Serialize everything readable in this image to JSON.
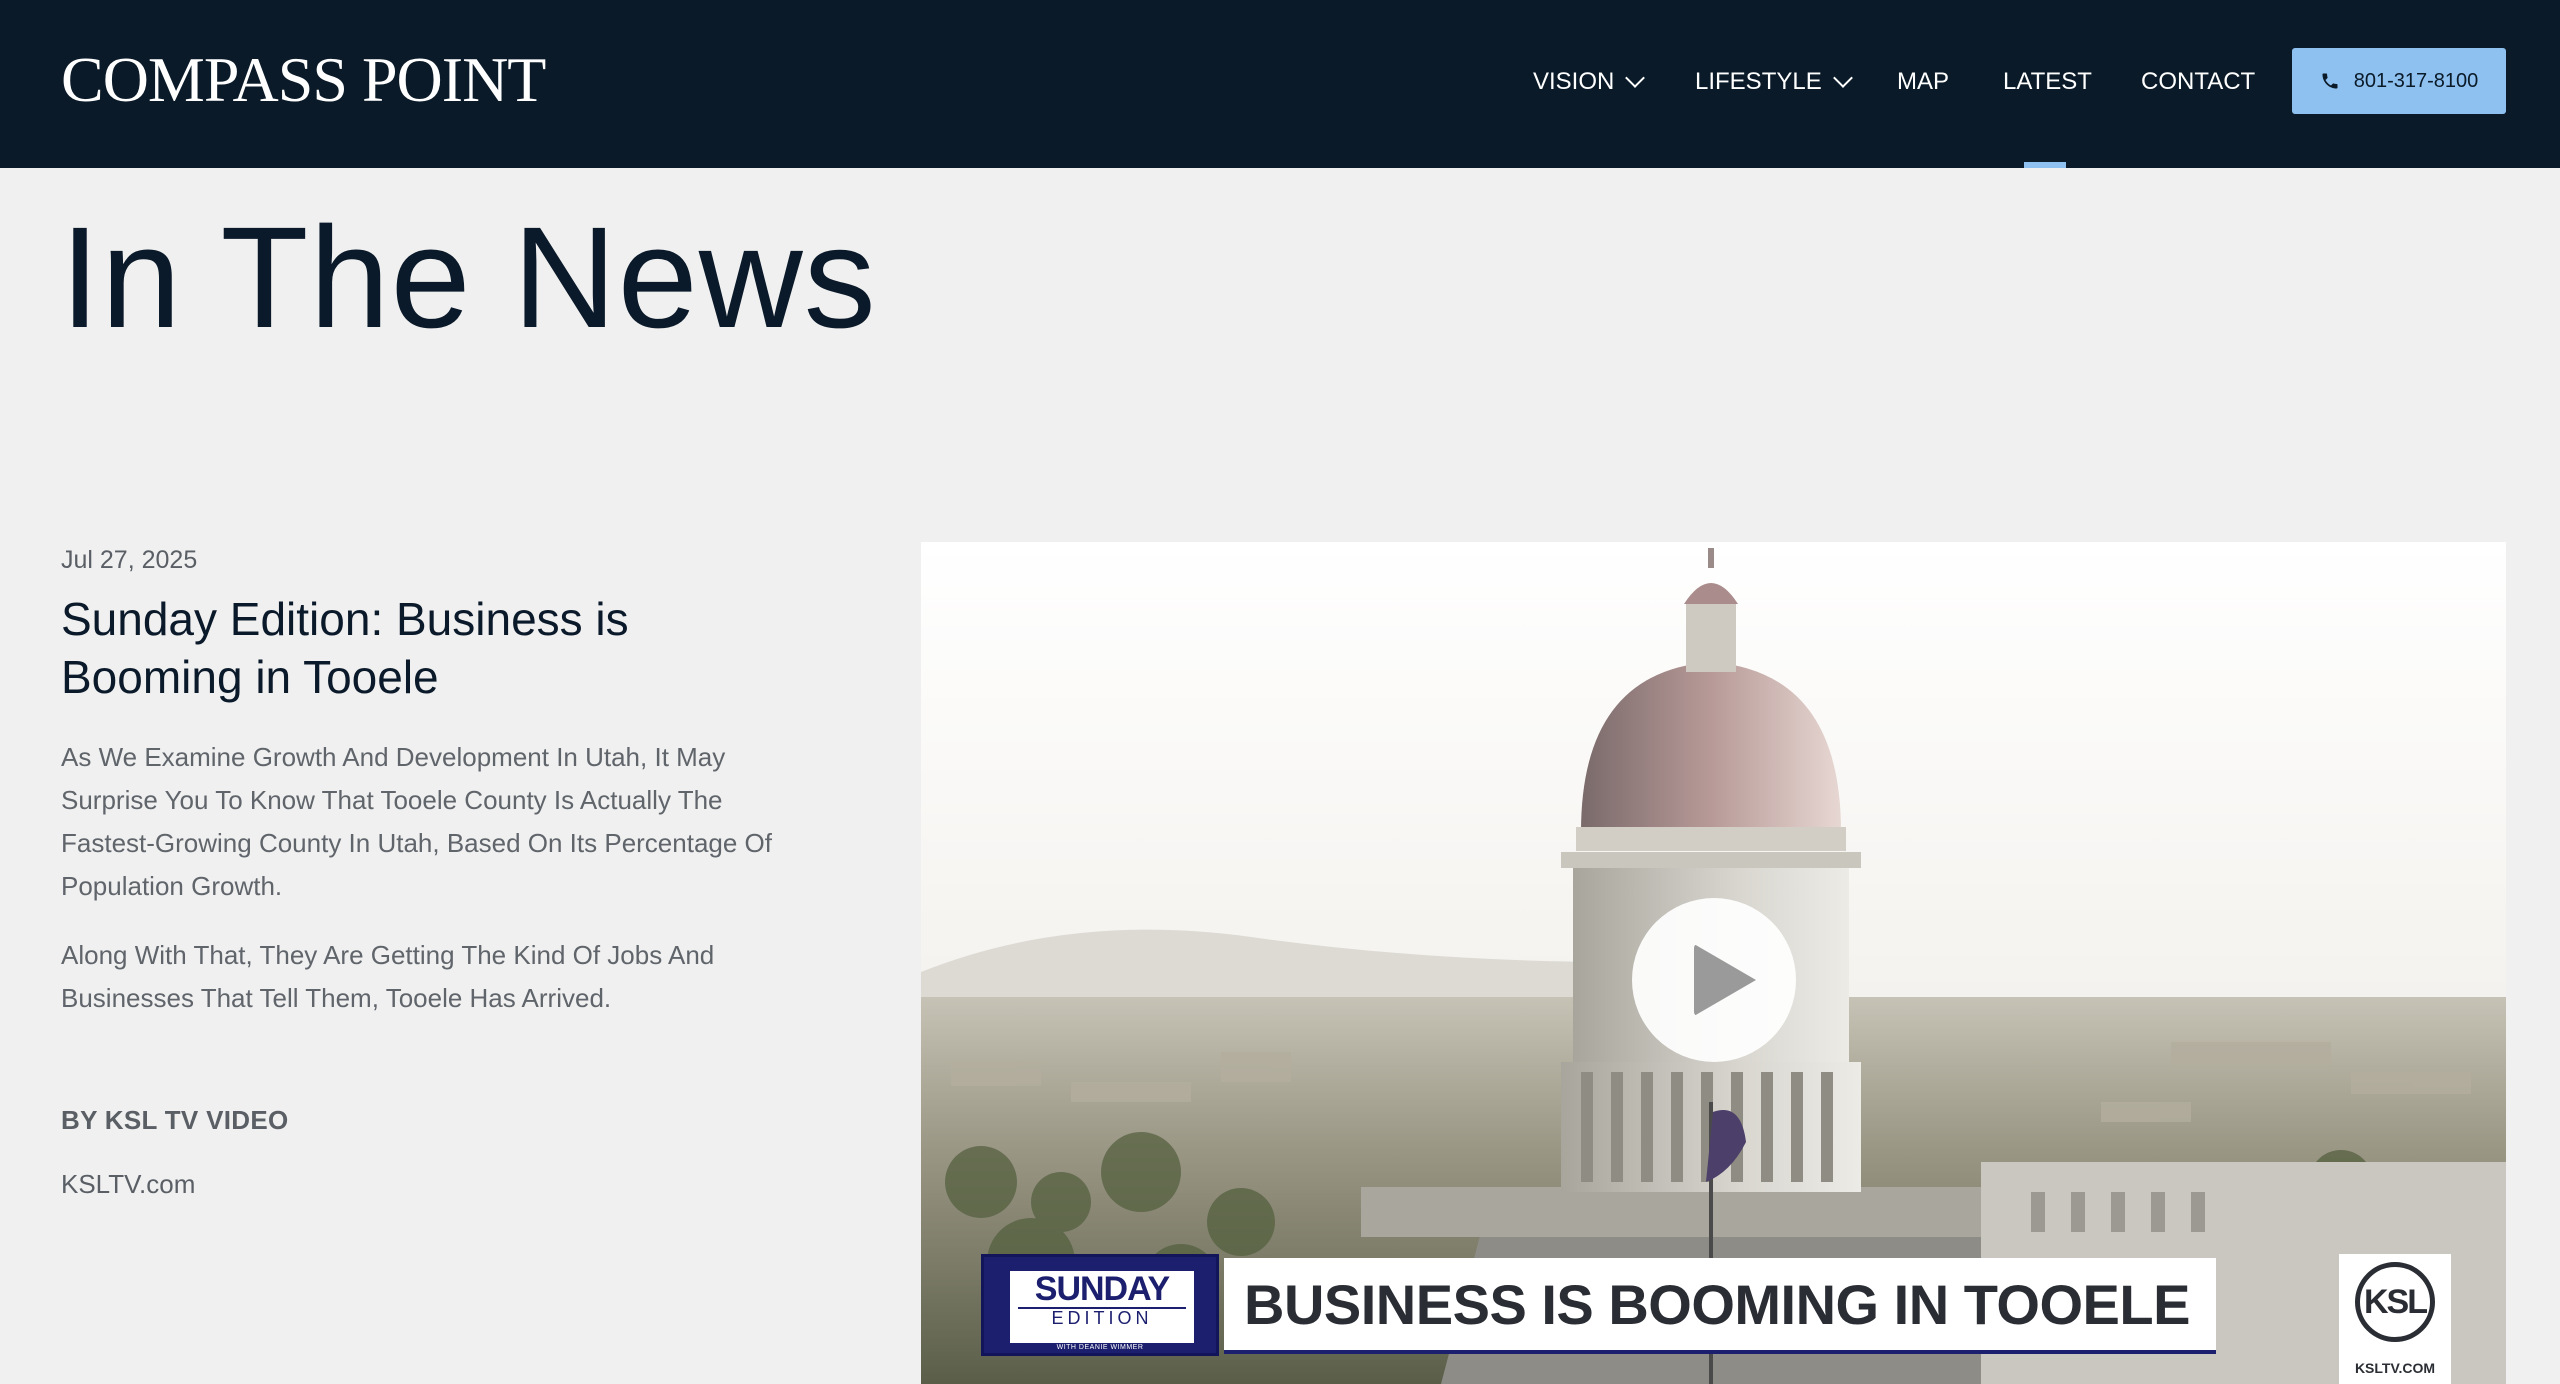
{
  "header": {
    "logo": "COMPASS POINT",
    "nav": [
      {
        "label": "VISION",
        "has_dropdown": true
      },
      {
        "label": "LIFESTYLE",
        "has_dropdown": true
      },
      {
        "label": "MAP",
        "has_dropdown": false
      },
      {
        "label": "LATEST",
        "has_dropdown": false,
        "active": true
      },
      {
        "label": "CONTACT",
        "has_dropdown": false
      }
    ],
    "phone": "801-317-8100",
    "phone_icon": "phone-icon"
  },
  "page": {
    "title": "In The News"
  },
  "article": {
    "date": "Jul 27, 2025",
    "title": "Sunday Edition: Business is Booming in Tooele",
    "paragraphs": [
      "As We Examine Growth And Development In Utah, It May Surprise You To Know That Tooele County Is Actually The Fastest-Growing County In Utah, Based On Its Percentage Of Population Growth.",
      "Along With That, They Are Getting The Kind Of Jobs And Businesses That Tell Them, Tooele Has Arrived."
    ],
    "byline": "BY KSL TV VIDEO",
    "source": "KSLTV.com"
  },
  "video": {
    "show_name": "SUNDAY",
    "show_sub": "EDITION",
    "show_host": "WITH DEANIE WIMMER",
    "headline": "BUSINESS IS BOOMING IN TOOELE",
    "station_logo": "KSL",
    "station_url": "KSLTV.COM",
    "play_icon": "play-icon"
  },
  "colors": {
    "header_bg": "#0a1a28",
    "accent": "#8ec1ef",
    "page_bg": "#f0f0f0",
    "broadcast_navy": "#1b1f6e"
  }
}
